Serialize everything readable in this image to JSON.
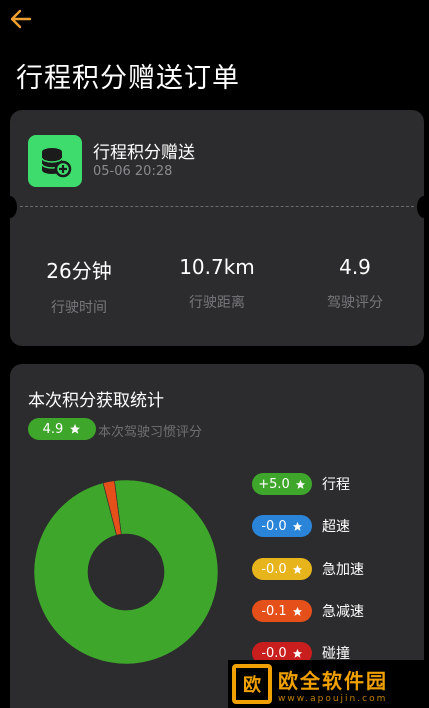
{
  "header": {
    "back_icon": "arrow-left-icon",
    "accent_color": "#f0a030",
    "title": "行程积分赠送订单"
  },
  "order": {
    "icon": "coin-stack-add-icon",
    "icon_color": "#3ddc6d",
    "name": "行程积分赠送",
    "time": "05-06 20:28",
    "metrics": [
      {
        "value": "26分钟",
        "label": "行驶时间"
      },
      {
        "value": "10.7km",
        "label": "行驶距离"
      },
      {
        "value": "4.9",
        "label": "驾驶评分"
      }
    ]
  },
  "stats": {
    "title": "本次积分获取统计",
    "score": "4.9",
    "score_icon": "star-icon",
    "score_desc": "本次驾驶习惯评分",
    "legend": [
      {
        "value": "+5.0",
        "name": "行程",
        "color": "#3ea62b",
        "icon": "star-icon"
      },
      {
        "value": "-0.0",
        "name": "超速",
        "color": "#2a84d8",
        "icon": "star-icon"
      },
      {
        "value": "-0.0",
        "name": "急加速",
        "color": "#e8b41c",
        "icon": "star-icon"
      },
      {
        "value": "-0.1",
        "name": "急减速",
        "color": "#e5501a",
        "icon": "star-icon"
      },
      {
        "value": "-0.0",
        "name": "碰撞",
        "color": "#c81e1e",
        "icon": "star-icon"
      }
    ]
  },
  "chart_data": {
    "type": "pie",
    "donut": true,
    "categories": [
      "行程",
      "急减速"
    ],
    "values": [
      4.9,
      0.1
    ],
    "colors": [
      "#3ea62b",
      "#e5501a"
    ]
  },
  "watermark": {
    "logo_char": "欧",
    "text": "欧全软件园",
    "url_text": "www.apoujin.com"
  }
}
